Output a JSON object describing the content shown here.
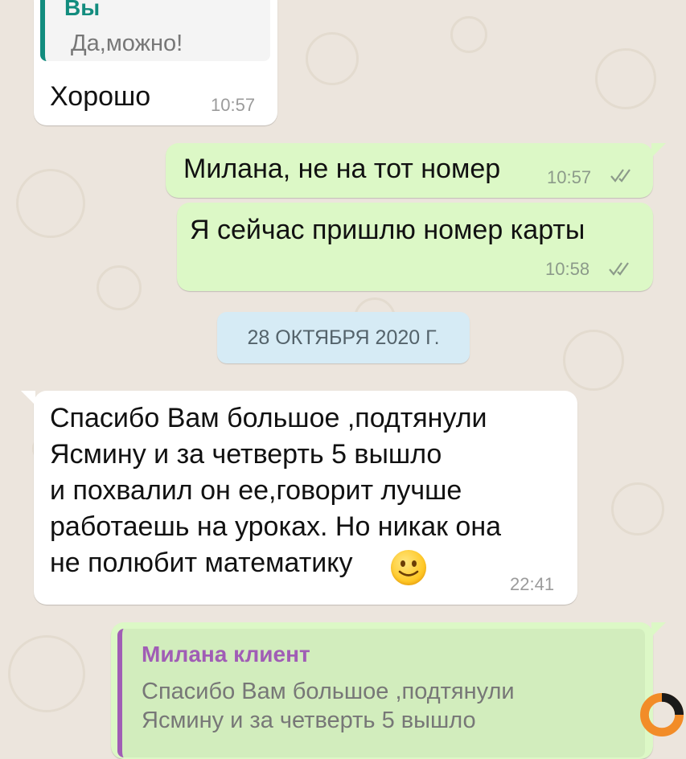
{
  "wallpaper": {
    "color": "#ece5dd"
  },
  "messages": [
    {
      "id": "m1",
      "direction": "incoming",
      "quote": {
        "author": "Вы",
        "text": "Да,можно!",
        "accent": "#128c7e"
      },
      "text": "Хорошо",
      "time": "10:57"
    },
    {
      "id": "m2",
      "direction": "outgoing",
      "text": "Милана, не на тот номер",
      "time": "10:57",
      "status": "read"
    },
    {
      "id": "m3",
      "direction": "outgoing",
      "text": "Я сейчас пришлю номер карты",
      "time": "10:58",
      "status": "read"
    },
    {
      "id": "m4",
      "direction": "incoming",
      "text": "Спасибо Вам большое ,подтянули\nЯсмину и за четверть 5 вышло\nи похвалил он ее,говорит лучше\nработаешь на уроках. Но никак она\nне полюбит математику",
      "emoji": "slightly-smiling-face",
      "time": "22:41"
    },
    {
      "id": "m5",
      "direction": "outgoing",
      "quote": {
        "author": "Милана клиент",
        "text": "Спасибо Вам большое ,подтянули\nЯсмину и за четверть 5 вышло",
        "accent": "#a05db5"
      }
    }
  ],
  "date_separator": "28 ОКТЯБРЯ 2020 Г.",
  "watermark": {
    "icon": "brand-logo-icon",
    "colors": [
      "#f28c28",
      "#1a1a1a"
    ]
  },
  "colors": {
    "incoming_bubble": "#ffffff",
    "outgoing_bubble": "#dcf8c6",
    "date_chip": "#d6ebf5",
    "read_ticks": "#8c9a8a"
  }
}
